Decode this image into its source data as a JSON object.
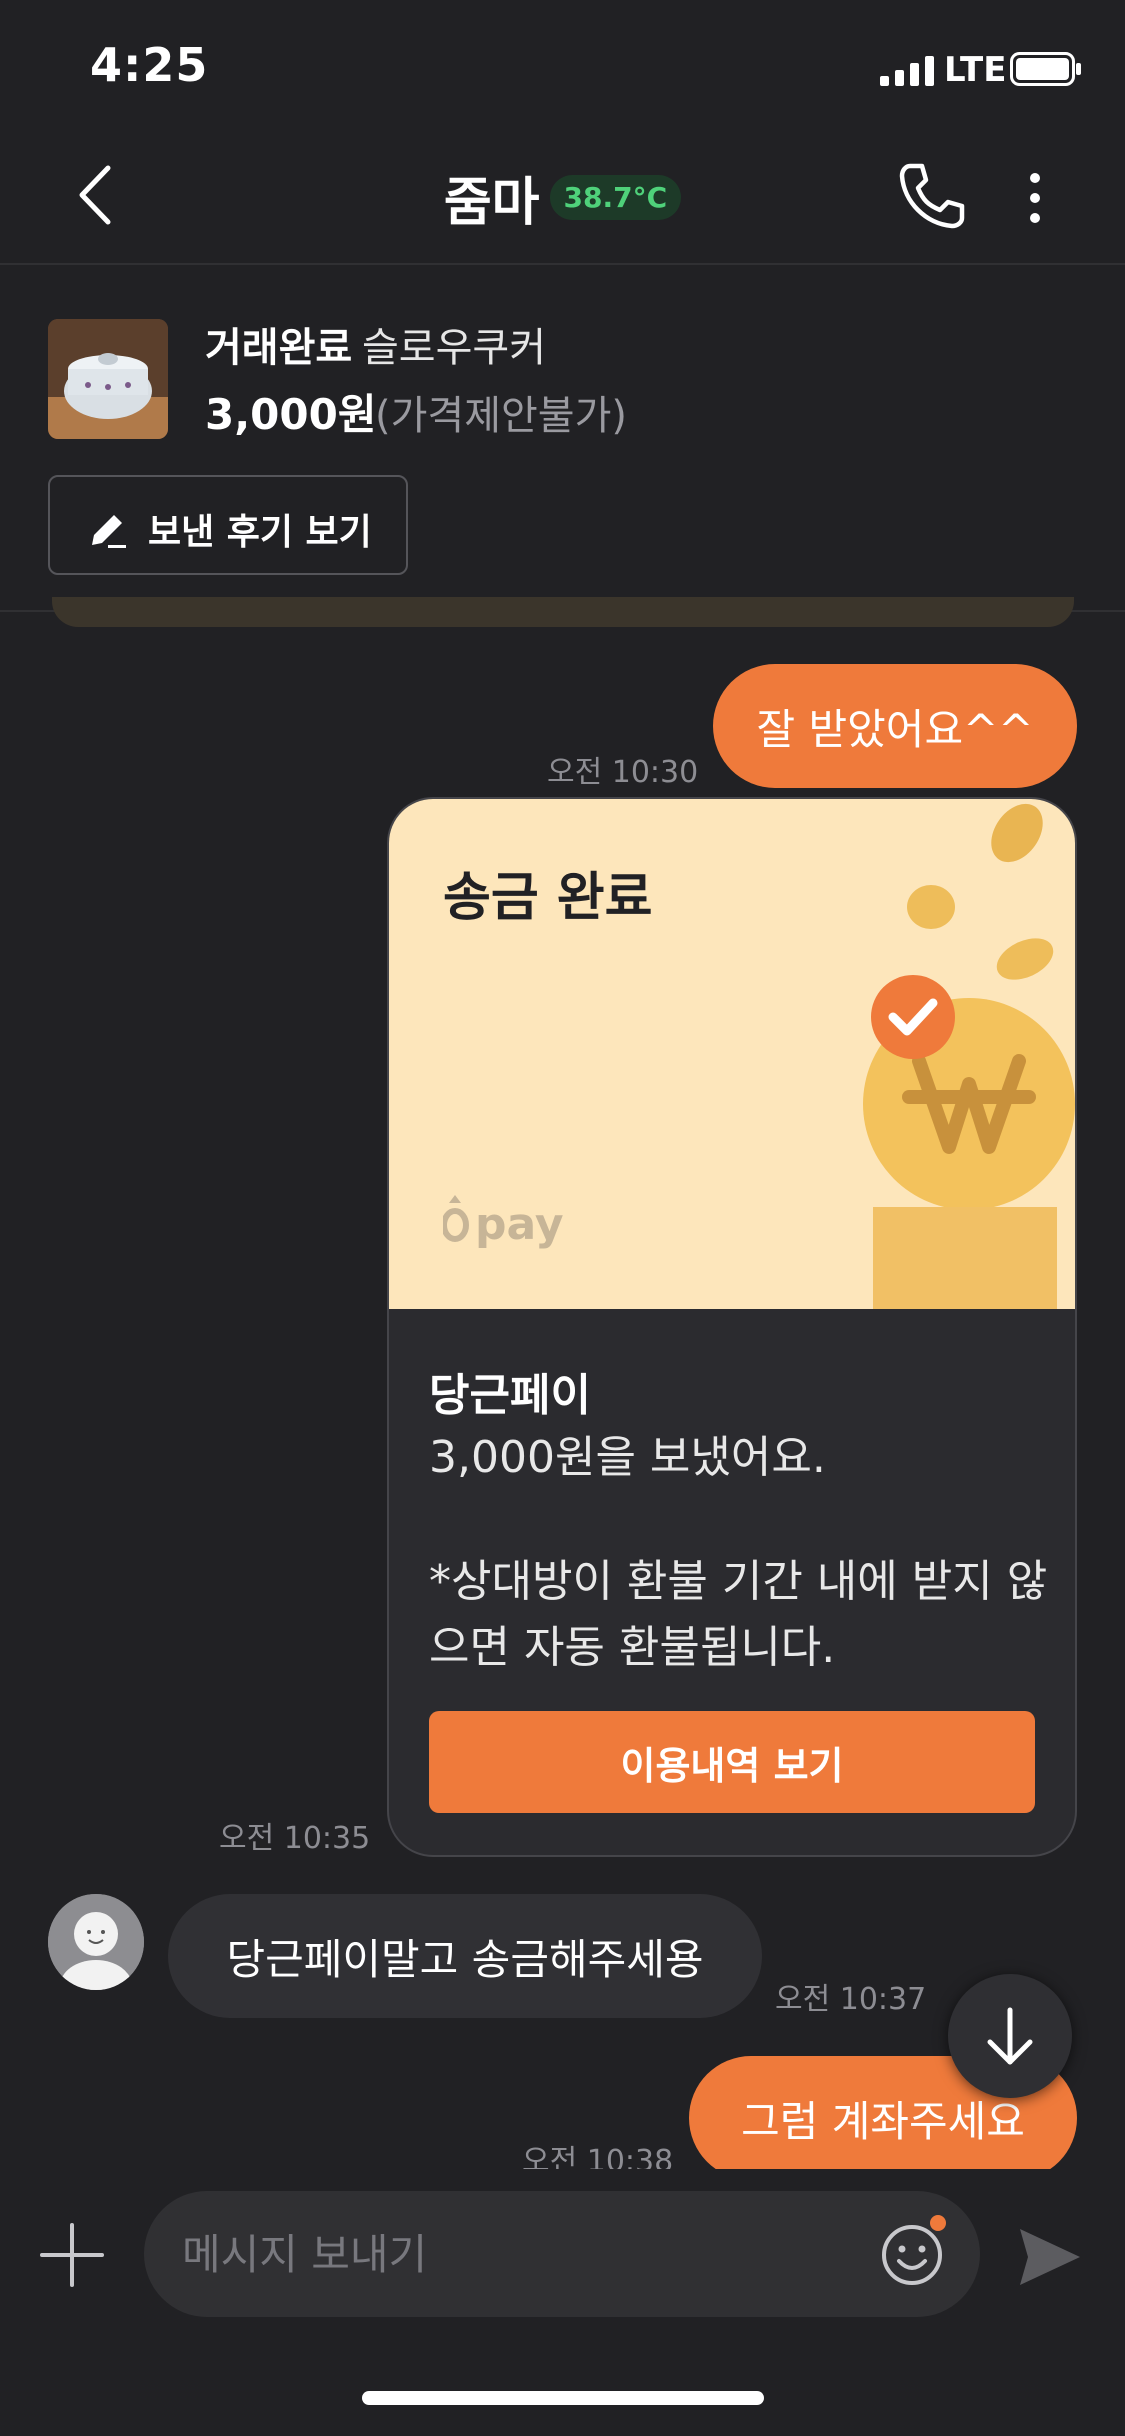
{
  "status_bar": {
    "time": "4:25",
    "network": "LTE"
  },
  "header": {
    "title": "줌마",
    "temperature": "38.7°C"
  },
  "product": {
    "status": "거래완료",
    "name": "슬로우쿠커",
    "price": "3,000원",
    "price_note": "(가격제안불가)",
    "review_button": "보낸 후기 보기"
  },
  "messages": {
    "m1": {
      "text": "잘 받았어요^^",
      "time": "오전 10:30"
    },
    "pay_card": {
      "title": "송금 완료",
      "logo_text": "pay",
      "brand": "당근페이",
      "line1": "3,000원을 보냈어요.",
      "line2": "*상대방이 환불 기간 내에 받지 않으면 자동 환불됩니다.",
      "button": "이용내역 보기",
      "time": "오전 10:35"
    },
    "m3": {
      "text": "당근페이말고 송금해주세용",
      "time": "오전 10:37"
    },
    "m4": {
      "text": "그럼 계좌주세요",
      "time": "오전 10:38"
    }
  },
  "input": {
    "placeholder": "메시지 보내기"
  },
  "colors": {
    "accent": "#ef7a3b",
    "background": "#212124",
    "temperature": "#4fd17a"
  }
}
